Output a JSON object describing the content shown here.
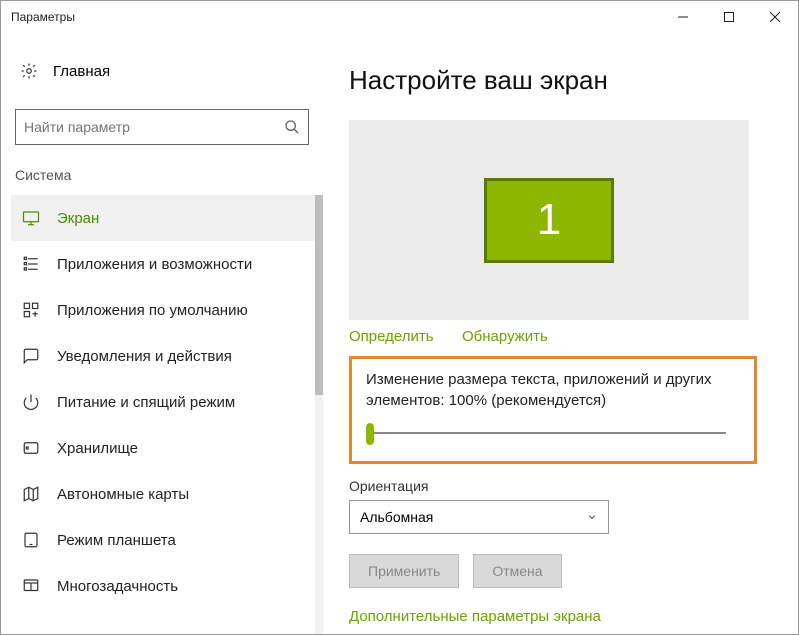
{
  "window": {
    "title": "Параметры"
  },
  "sidebar": {
    "home": "Главная",
    "search_placeholder": "Найти параметр",
    "section": "Система",
    "items": [
      {
        "label": "Экран"
      },
      {
        "label": "Приложения и возможности"
      },
      {
        "label": "Приложения по умолчанию"
      },
      {
        "label": "Уведомления и действия"
      },
      {
        "label": "Питание и спящий режим"
      },
      {
        "label": "Хранилище"
      },
      {
        "label": "Автономные карты"
      },
      {
        "label": "Режим планшета"
      },
      {
        "label": "Многозадачность"
      }
    ]
  },
  "main": {
    "heading": "Настройте ваш экран",
    "monitor_num": "1",
    "link_identify": "Определить",
    "link_detect": "Обнаружить",
    "scale_label": "Изменение размера текста, приложений и других элементов: 100% (рекомендуется)",
    "orientation_label": "Ориентация",
    "orientation_value": "Альбомная",
    "apply": "Применить",
    "cancel": "Отмена",
    "advanced": "Дополнительные параметры экрана"
  }
}
